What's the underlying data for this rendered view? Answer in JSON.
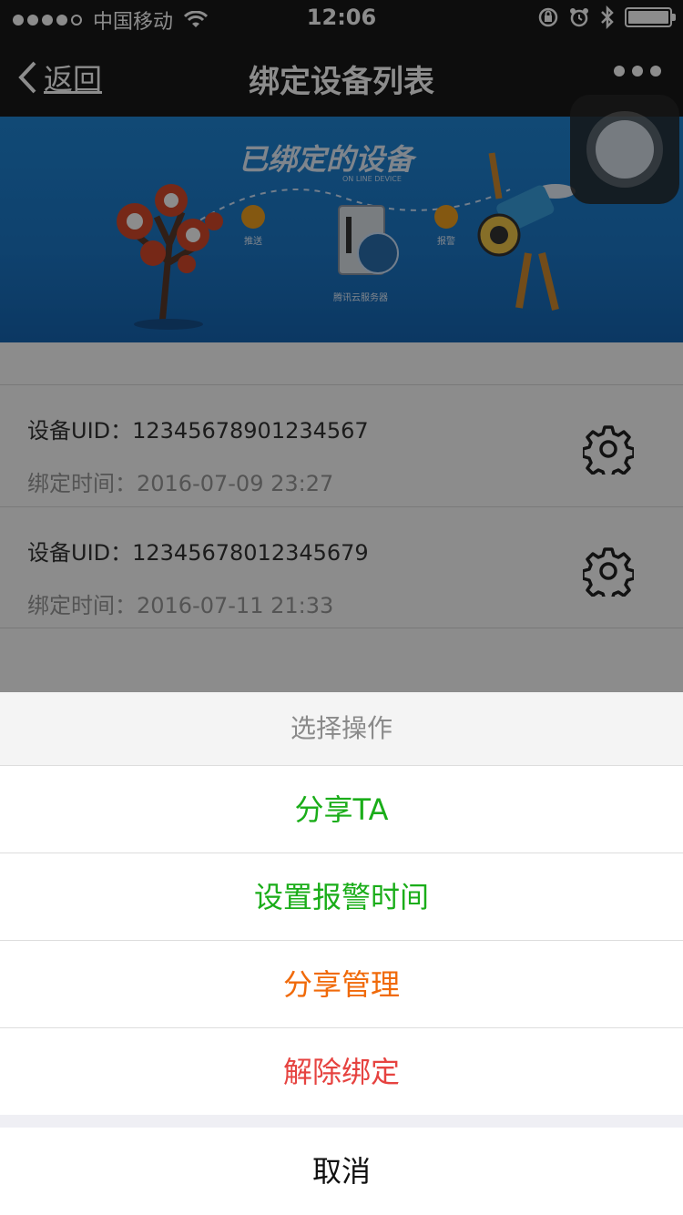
{
  "status_bar": {
    "carrier": "中国移动",
    "time": "12:06"
  },
  "nav": {
    "back_label": "返回",
    "title": "绑定设备列表"
  },
  "banner": {
    "title": "已绑定的设备",
    "subtitle": "ON LINE DEVICE",
    "push_label": "推送",
    "alarm_label": "报警",
    "server_label": "腾讯云服务器"
  },
  "devices": [
    {
      "uid": "设备UID：12345678901234567",
      "bind_time": "绑定时间：2016-07-09 23:27"
    },
    {
      "uid": "设备UID：12345678012345679",
      "bind_time": "绑定时间：2016-07-11 21:33"
    }
  ],
  "sheet": {
    "title": "选择操作",
    "options": [
      {
        "label": "分享TA",
        "color": "#1aad19"
      },
      {
        "label": "设置报警时间",
        "color": "#1aad19"
      },
      {
        "label": "分享管理",
        "color": "#f06a0a"
      },
      {
        "label": "解除绑定",
        "color": "#e64340"
      }
    ],
    "cancel": "取消"
  }
}
